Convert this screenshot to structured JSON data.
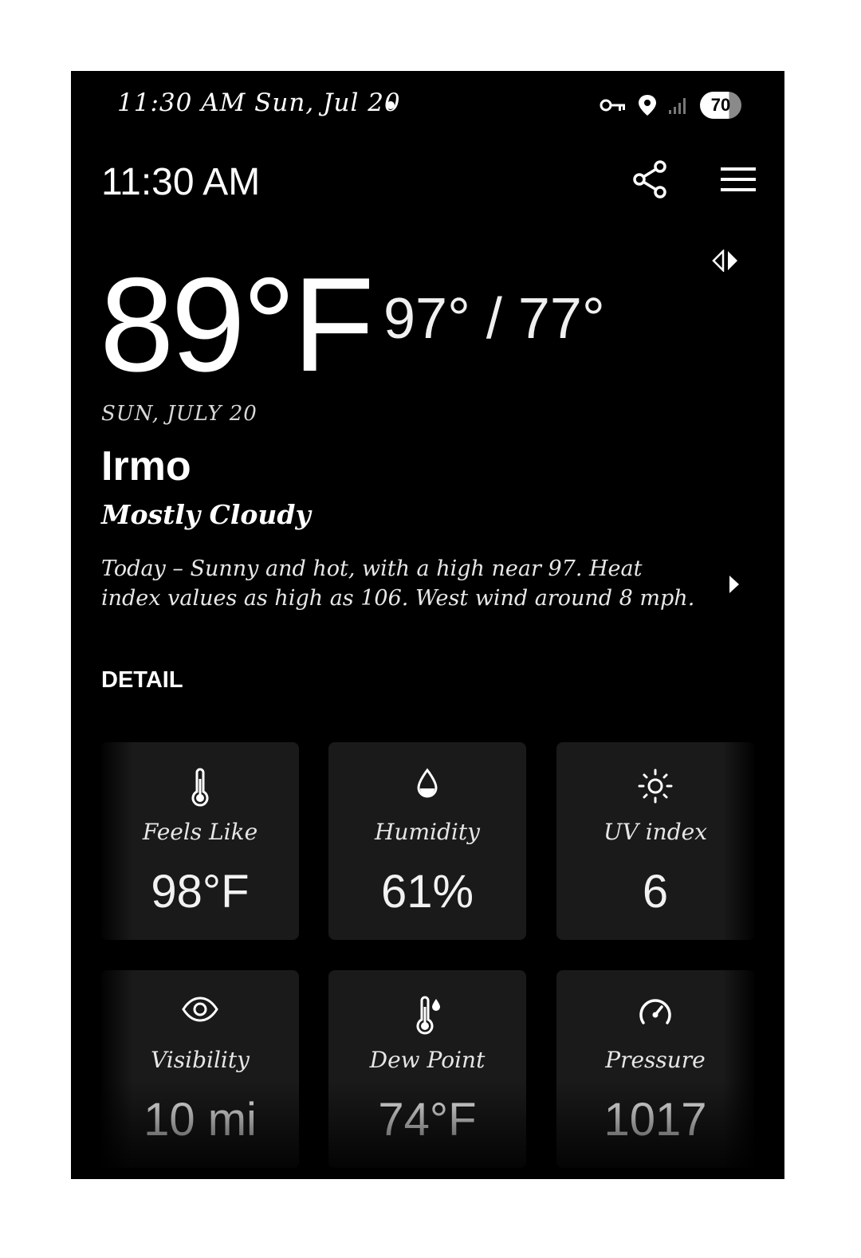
{
  "status_bar": {
    "time_date": "11:30 AM  Sun, Jul 20",
    "battery": "70"
  },
  "header": {
    "time": "11:30 AM"
  },
  "current": {
    "temperature": "89°F",
    "high_low": "97° / 77°",
    "date": "SUN, JULY 20",
    "city": "Irmo",
    "condition": "Mostly Cloudy",
    "forecast": "Today – Sunny and hot, with a high near 97. Heat index values as high as 106. West wind around 8 mph."
  },
  "detail": {
    "title": "DETAIL",
    "cards": [
      {
        "label": "Feels Like",
        "value": "98°F",
        "icon": "thermometer-icon"
      },
      {
        "label": "Humidity",
        "value": "61%",
        "icon": "droplet-icon"
      },
      {
        "label": "UV index",
        "value": "6",
        "icon": "sun-icon"
      },
      {
        "label": "Visibility",
        "value": "10 mi",
        "icon": "eye-icon"
      },
      {
        "label": "Dew Point",
        "value": "74°F",
        "icon": "dew-thermometer-icon"
      },
      {
        "label": "Pressure",
        "value": "1017",
        "icon": "gauge-icon"
      }
    ]
  },
  "colors": {
    "background": "#000000",
    "card": "#1a1a1a",
    "text": "#ffffff"
  }
}
